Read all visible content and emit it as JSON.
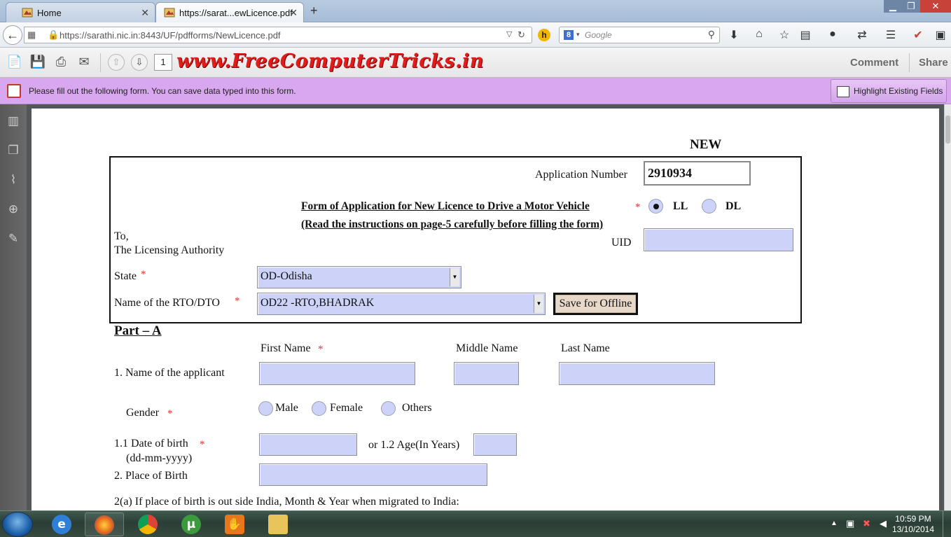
{
  "browser": {
    "tabs": [
      {
        "label": "Home",
        "close": "✕"
      },
      {
        "label": "https://sarat...ewLicence.pdf",
        "close": "✕"
      }
    ],
    "new_tab": "+",
    "window_controls": [
      "▁",
      "❐",
      "✕"
    ],
    "url": "https://sarathi.nic.in:8443/UF/pdfforms/NewLicence.pdf",
    "search_engine_badge": "8",
    "search_placeholder": "Google",
    "h_badge": "h"
  },
  "pdf_toolbar": {
    "page_number": "1",
    "watermark": "www.FreeComputerTricks.in",
    "comment_label": "Comment",
    "share_label": "Share"
  },
  "notice": {
    "message": "Please fill out the following form. You can save data typed into this form.",
    "highlight_button": "Highlight Existing Fields"
  },
  "form": {
    "new_label": "NEW",
    "application_number_label": "Application Number",
    "application_number_value": "2910934",
    "title_line1": "Form of Application for New Licence to Drive a Motor Vehicle",
    "title_line2": "(Read the instructions on page-5 carefully before filling the form)",
    "licence_type_options": [
      "LL",
      "DL"
    ],
    "licence_type_selected": "LL",
    "uid_label": "UID",
    "to_line1": "To,",
    "to_line2": "The Licensing Authority",
    "state_label": "State",
    "state_value": "OD-Odisha",
    "rto_label": "Name of the RTO/DTO",
    "rto_value": "OD22 -RTO,BHADRAK",
    "save_offline_button": "Save for Offline",
    "part_a_heading": "Part – A",
    "first_name_label": "First Name",
    "middle_name_label": "Middle Name",
    "last_name_label": "Last Name",
    "applicant_name_label": "1. Name of the applicant",
    "gender_label": "Gender",
    "gender_options": [
      "Male",
      "Female",
      "Others"
    ],
    "dob_label": "1.1 Date of birth",
    "dob_format": "(dd-mm-yyyy)",
    "age_label": "or 1.2 Age(In Years)",
    "place_of_birth_label": "2. Place of Birth",
    "migration_label": "2(a) If place of birth is out side India, Month & Year when migrated to India:",
    "required_marker": "*"
  },
  "taskbar": {
    "time": "10:59 PM",
    "date": "13/10/2014"
  }
}
